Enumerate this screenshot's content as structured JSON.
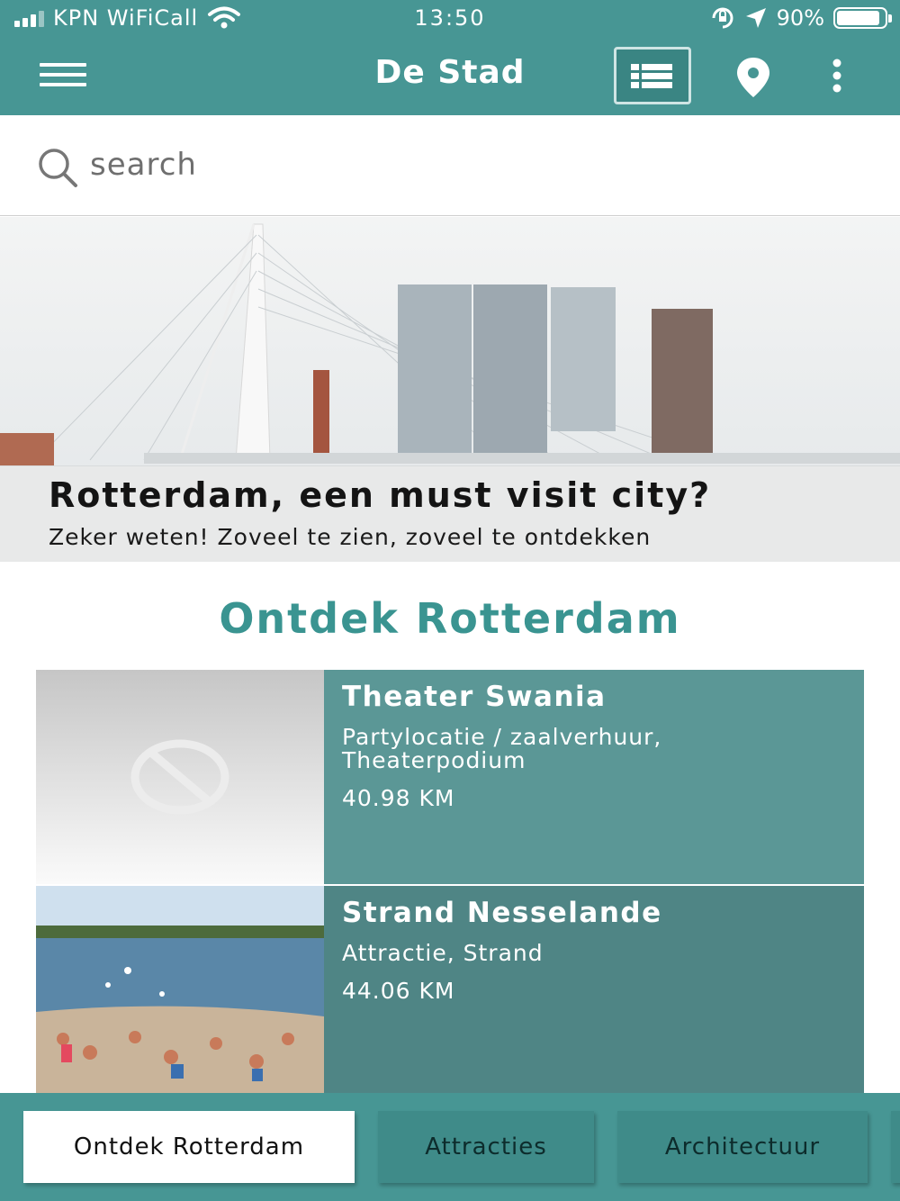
{
  "status_bar": {
    "carrier": "KPN WiFiCall",
    "time": "13:50",
    "battery": "90%",
    "battery_level": 0.9
  },
  "header": {
    "title": "De Stad",
    "menu_icon": "hamburger-menu-icon",
    "list_icon": "list-view-icon",
    "map_icon": "map-pin-icon",
    "more_icon": "more-vertical-icon"
  },
  "search": {
    "placeholder": "search"
  },
  "hero": {
    "title": "Rotterdam, een must visit city?",
    "subtitle": "Zeker weten! Zoveel te zien, zoveel te ontdekken"
  },
  "section": {
    "title": "Ontdek Rotterdam"
  },
  "places": [
    {
      "name": "Theater Swania",
      "categories": "Partylocatie / zaalverhuur, Theaterpodium",
      "distance": "40.98 KM",
      "image": "no-image-icon"
    },
    {
      "name": "Strand Nesselande",
      "categories": "Attractie, Strand",
      "distance": "44.06 KM",
      "image": "beach-photo"
    }
  ],
  "tabs": [
    {
      "label": "Ontdek Rotterdam",
      "active": true
    },
    {
      "label": "Attracties",
      "active": false
    },
    {
      "label": "Architectuur",
      "active": false
    },
    {
      "label": "",
      "active": false
    }
  ],
  "colors": {
    "primary": "#479694",
    "heading": "#3a9491",
    "card1": "#5b9796",
    "card2": "#4f8585"
  }
}
